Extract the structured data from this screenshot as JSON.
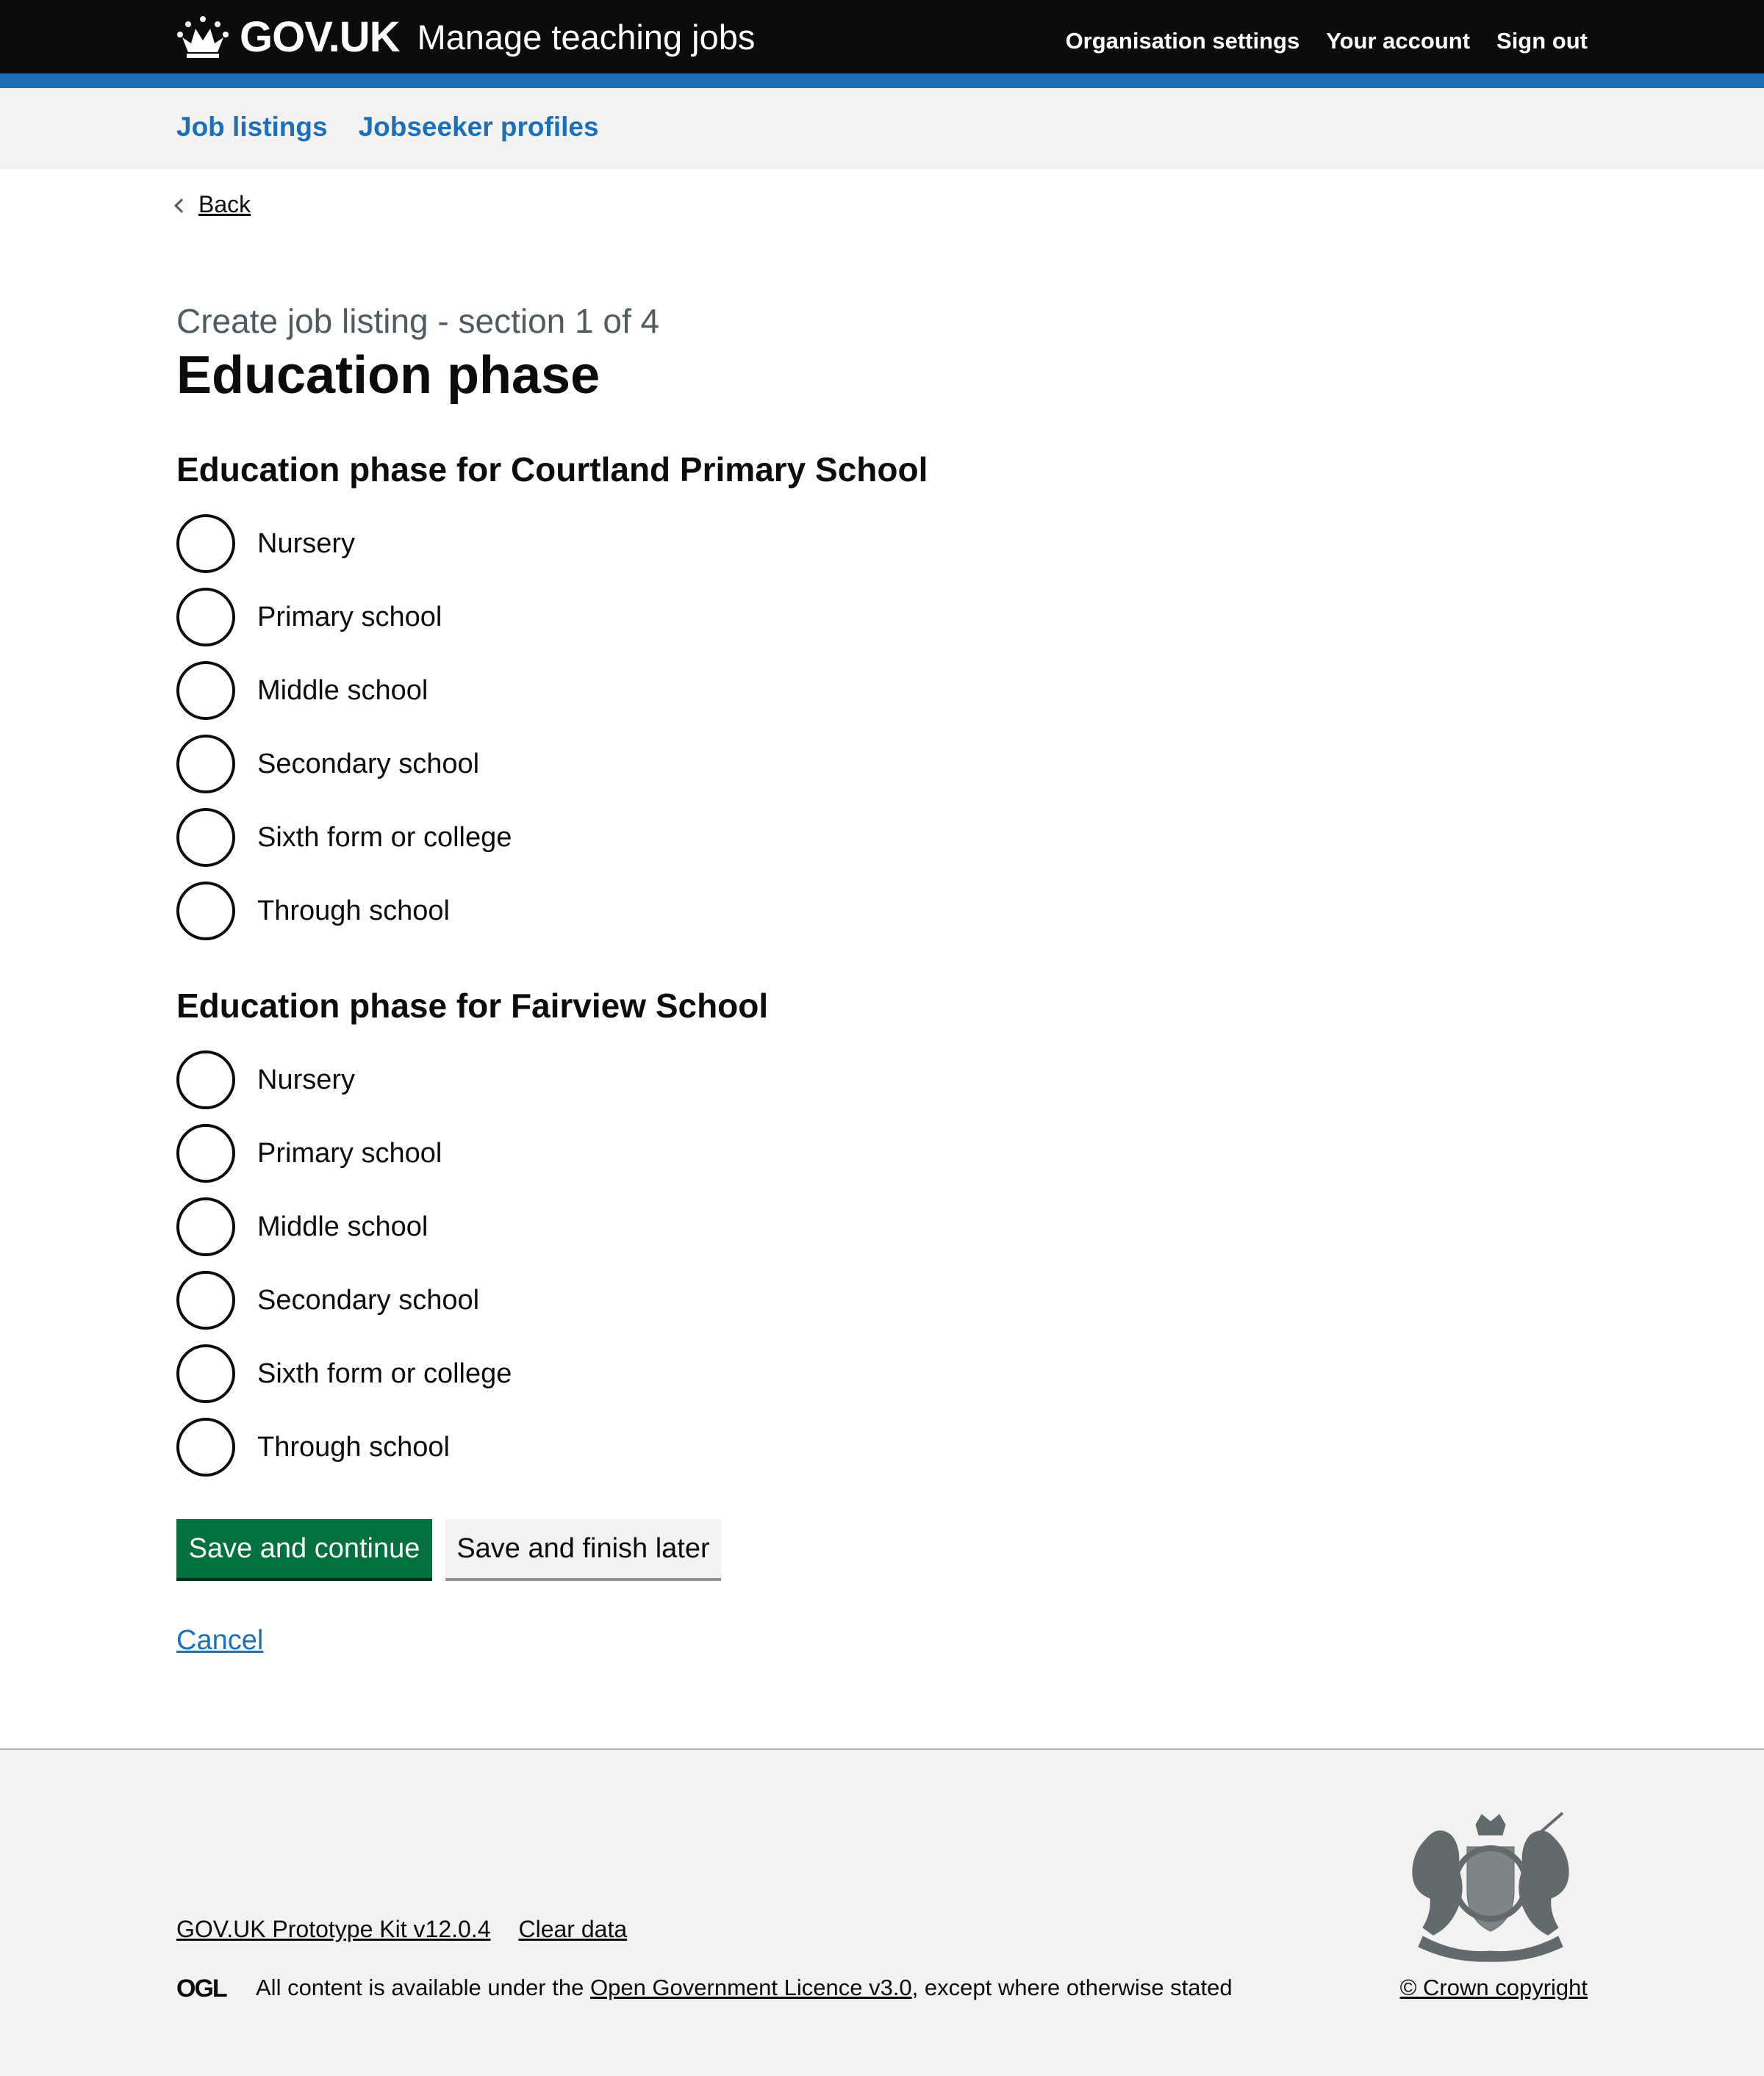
{
  "header": {
    "logo_text": "GOV.UK",
    "service_name": "Manage teaching jobs",
    "nav": [
      "Organisation settings",
      "Your account",
      "Sign out"
    ]
  },
  "subnav": {
    "items": [
      "Job listings",
      "Jobseeker profiles"
    ]
  },
  "back_label": "Back",
  "caption": "Create job listing - section 1 of 4",
  "title": "Education phase",
  "groups": [
    {
      "legend": "Education phase for Courtland Primary School",
      "options": [
        "Nursery",
        "Primary school",
        "Middle school",
        "Secondary school",
        "Sixth form or college",
        "Through school"
      ]
    },
    {
      "legend": "Education phase for Fairview School",
      "options": [
        "Nursery",
        "Primary school",
        "Middle school",
        "Secondary school",
        "Sixth form or college",
        "Through school"
      ]
    }
  ],
  "buttons": {
    "primary": "Save and continue",
    "secondary": "Save and finish later"
  },
  "cancel_label": "Cancel",
  "footer": {
    "links": [
      "GOV.UK Prototype Kit v12.0.4",
      "Clear data"
    ],
    "licence_prefix": "All content is available under the",
    "licence_link": "Open Government Licence v3.0",
    "licence_suffix": ", except where otherwise stated",
    "copyright": "© Crown copyright"
  },
  "colors": {
    "header": "#0b0c0c",
    "accent_bar": "#1d70b8",
    "primary_button": "#00703c",
    "link": "#1d70b8"
  }
}
